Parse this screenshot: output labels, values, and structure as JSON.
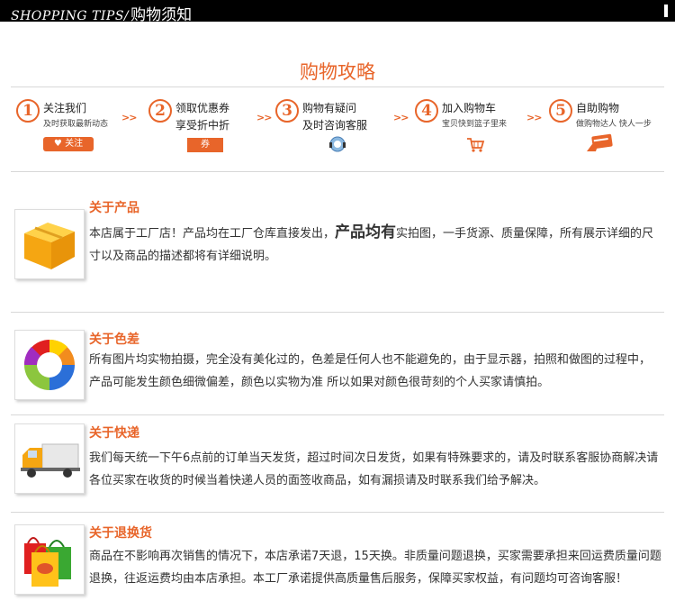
{
  "header": {
    "title_en": "SHOPPING TIPS/",
    "title_zh": "购物须知"
  },
  "guide": {
    "title": "购物攻略",
    "steps": [
      {
        "num": "1",
        "title": "关注我们",
        "sub": "及时获取最新动态",
        "button": "关注"
      },
      {
        "num": "2",
        "title": "领取优惠券",
        "sub": "享受折中折",
        "button": "券"
      },
      {
        "num": "3",
        "title": "购物有疑问",
        "sub": "及时咨询客服"
      },
      {
        "num": "4",
        "title": "加入购物车",
        "sub": "宝贝快到篮子里来"
      },
      {
        "num": "5",
        "title": "自助购物",
        "sub": "做购物达人  快人一步"
      }
    ],
    "arrow": ">>"
  },
  "sections": [
    {
      "title": "关于产品",
      "text_before": "本店属于工厂店！产品均在工厂仓库直接发出，",
      "text_big": "产品均有",
      "text_after": "实拍图，一手货源、质量保障，所有展示详细的尺寸以及商品的描述都将有详细说明。",
      "icon": "box-icon"
    },
    {
      "title": "关于色差",
      "text": "所有图片均实物拍摄，完全没有美化过的，色差是任何人也不能避免的，由于显示器，拍照和做图的过程中，产品可能发生颜色细微偏差，颜色以实物为准   所以如果对颜色很苛刻的个人买家请慎拍。",
      "icon": "color-wheel-icon"
    },
    {
      "title": "关于快递",
      "text": "我们每天统一下午6点前的订单当天发货，超过时间次日发货，如果有特殊要求的，请及时联系客服协商解决请各位买家在收货的时候当着快递人员的面签收商品，如有漏损请及时联系我们给予解决。",
      "icon": "truck-icon"
    },
    {
      "title": "关于退换货",
      "text": "商品在不影响再次销售的情况下，本店承诺7天退，15天换。非质量问题退换，买家需要承担来回运费质量问题退换，往返运费均由本店承担。本工厂承诺提供高质量售后服务，保障买家权益，有问题均可咨询客服！",
      "icon": "shopping-bags-icon"
    }
  ],
  "colors": {
    "accent": "#e8652a",
    "header_bg": "#000000",
    "divider": "#d8d8d8"
  }
}
